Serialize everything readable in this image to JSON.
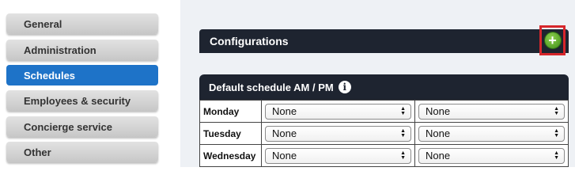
{
  "sidebar": {
    "items": [
      {
        "label": "General",
        "active": false
      },
      {
        "label": "Administration",
        "active": false
      },
      {
        "label": "Schedules",
        "active": true
      },
      {
        "label": "Employees & security",
        "active": false
      },
      {
        "label": "Concierge service",
        "active": false
      },
      {
        "label": "Other",
        "active": false
      }
    ]
  },
  "main": {
    "config_title": "Configurations",
    "add_icon": "plus-circle-icon",
    "schedule_title": "Default schedule AM / PM",
    "info_icon": "i",
    "rows": [
      {
        "day": "Monday",
        "am": "None",
        "pm": "None"
      },
      {
        "day": "Tuesday",
        "am": "None",
        "pm": "None"
      },
      {
        "day": "Wednesday",
        "am": "None",
        "pm": "None"
      }
    ]
  },
  "colors": {
    "accent": "#1e73c8",
    "header_bg": "#1e2430",
    "highlight": "#d6262b",
    "add_green": "#4fa82a"
  }
}
